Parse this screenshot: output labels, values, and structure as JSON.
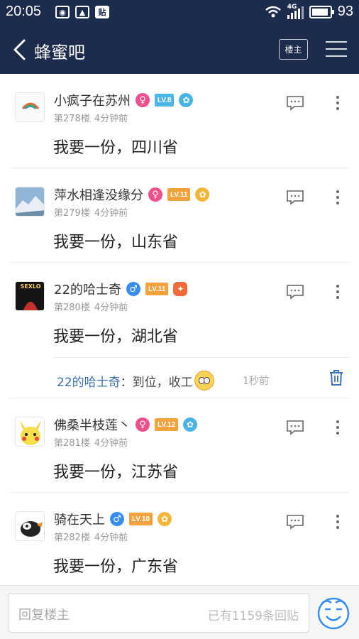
{
  "status_bar": {
    "time": "20:05",
    "network": "4G",
    "battery": "93",
    "battery_level": 0.93
  },
  "nav": {
    "title": "蜂蜜吧",
    "owner_label": "楼主"
  },
  "posts": [
    {
      "username": "小疯子在苏州",
      "gender": "♀",
      "level": "LV.8",
      "floor": "第278楼",
      "time": "4分钟前",
      "content": "我要一份，四川省"
    },
    {
      "username": "萍水相逢没缘分",
      "gender": "♀",
      "level": "LV.11",
      "floor": "第279楼",
      "time": "4分钟前",
      "content": "我要一份，山东省"
    },
    {
      "username": "22的哈士奇",
      "gender": "♂",
      "level": "LV.11",
      "floor": "第280楼",
      "time": "4分钟前",
      "content": "我要一份，湖北省"
    },
    {
      "username": "佛桑半枝莲丶",
      "gender": "♀",
      "level": "LV.12",
      "floor": "第281楼",
      "time": "4分钟前",
      "content": "我要一份，江苏省"
    },
    {
      "username": "骑在天上",
      "gender": "♂",
      "level": "LV.10",
      "floor": "第282楼",
      "time": "4分钟前",
      "content": "我要一份，广东省"
    }
  ],
  "sub_reply": {
    "author": "22的哈士奇",
    "separator": "：",
    "text": "到位，收工",
    "time": "1秒前"
  },
  "bottom": {
    "placeholder": "回复楼主",
    "reply_count": "已有1159条回贴"
  },
  "avatar_texts": {
    "post3": "SEXLO"
  },
  "colors": {
    "header_bg": "#1d2b4c",
    "female": "#ef4f8c",
    "male": "#3a8df0",
    "level_blue": "#4cb6e8",
    "level_orange": "#f4a23c",
    "link": "#3d6fb3"
  }
}
